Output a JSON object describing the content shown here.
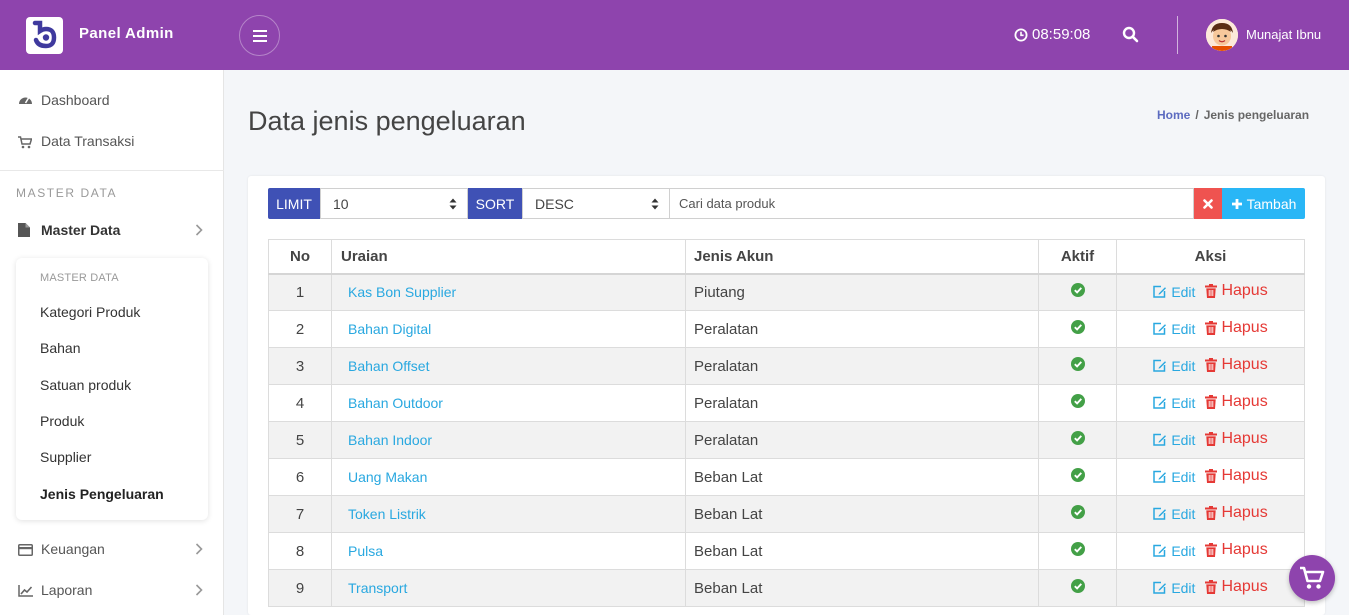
{
  "header": {
    "brand": "Panel Admin",
    "clock": "08:59:08",
    "user_name": "Munajat Ibnu",
    "accent": "#8e44ad"
  },
  "sidebar": {
    "items_top": [
      {
        "label": "Dashboard",
        "icon": "dashboard-icon"
      },
      {
        "label": "Data Transaksi",
        "icon": "cart-icon"
      }
    ],
    "section_heading": "MASTER DATA",
    "master": {
      "label": "Master Data",
      "icon": "file-icon"
    },
    "submenu": {
      "heading": "MASTER DATA",
      "items": [
        "Kategori Produk",
        "Bahan",
        "Satuan produk",
        "Produk",
        "Supplier",
        "Jenis Pengeluaran"
      ],
      "active": "Jenis Pengeluaran"
    },
    "items_bottom": [
      {
        "label": "Keuangan",
        "icon": "credit-card-icon"
      },
      {
        "label": "Laporan",
        "icon": "chart-icon"
      }
    ]
  },
  "page": {
    "title": "Data jenis pengeluaran",
    "breadcrumb_home": "Home",
    "breadcrumb_sep": "/",
    "breadcrumb_current": "Jenis pengeluaran"
  },
  "toolbar": {
    "limit_label": "LIMIT",
    "limit_value": "10",
    "sort_label": "SORT",
    "sort_value": "DESC",
    "search_placeholder": "Cari data produk",
    "add_label": "Tambah"
  },
  "table": {
    "headers": [
      "No",
      "Uraian",
      "Jenis Akun",
      "Aktif",
      "Aksi"
    ],
    "edit_label": "Edit",
    "delete_label": "Hapus",
    "rows": [
      {
        "no": "1",
        "uraian": "Kas Bon Supplier",
        "jenis": "Piutang",
        "aktif": true
      },
      {
        "no": "2",
        "uraian": "Bahan Digital",
        "jenis": "Peralatan",
        "aktif": true
      },
      {
        "no": "3",
        "uraian": "Bahan Offset",
        "jenis": "Peralatan",
        "aktif": true
      },
      {
        "no": "4",
        "uraian": "Bahan Outdoor",
        "jenis": "Peralatan",
        "aktif": true
      },
      {
        "no": "5",
        "uraian": "Bahan Indoor",
        "jenis": "Peralatan",
        "aktif": true
      },
      {
        "no": "6",
        "uraian": "Uang Makan",
        "jenis": "Beban Lat",
        "aktif": true
      },
      {
        "no": "7",
        "uraian": "Token Listrik",
        "jenis": "Beban Lat",
        "aktif": true
      },
      {
        "no": "8",
        "uraian": "Pulsa",
        "jenis": "Beban Lat",
        "aktif": true
      },
      {
        "no": "9",
        "uraian": "Transport",
        "jenis": "Beban Lat",
        "aktif": true
      }
    ]
  }
}
